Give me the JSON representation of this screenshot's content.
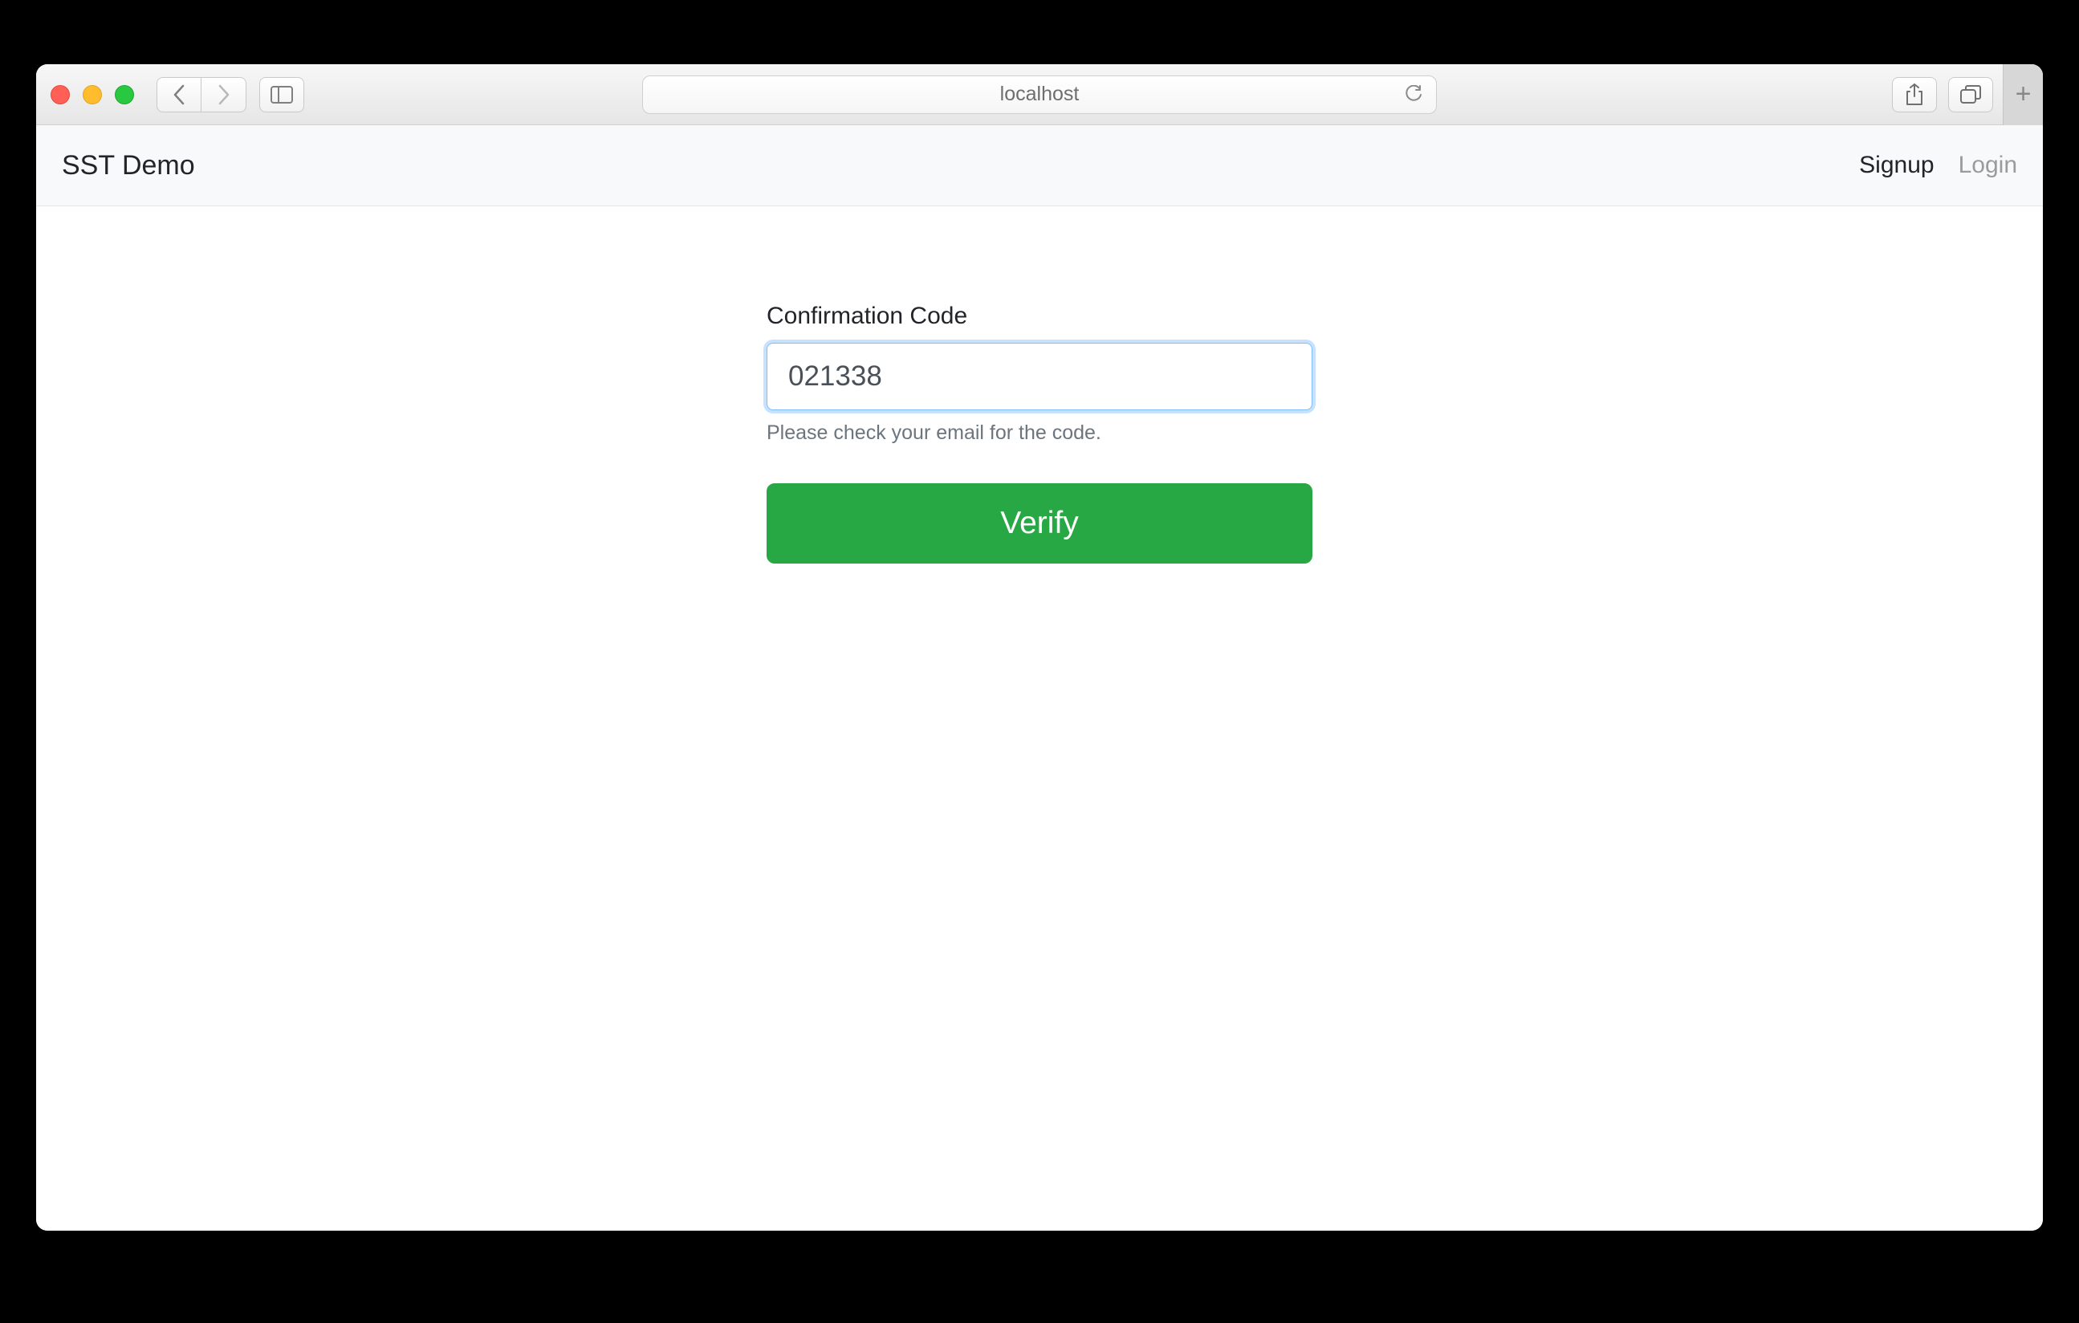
{
  "browser": {
    "address": "localhost"
  },
  "navbar": {
    "brand": "SST Demo",
    "signup": "Signup",
    "login": "Login"
  },
  "form": {
    "label": "Confirmation Code",
    "value": "021338",
    "help": "Please check your email for the code.",
    "submit": "Verify"
  }
}
